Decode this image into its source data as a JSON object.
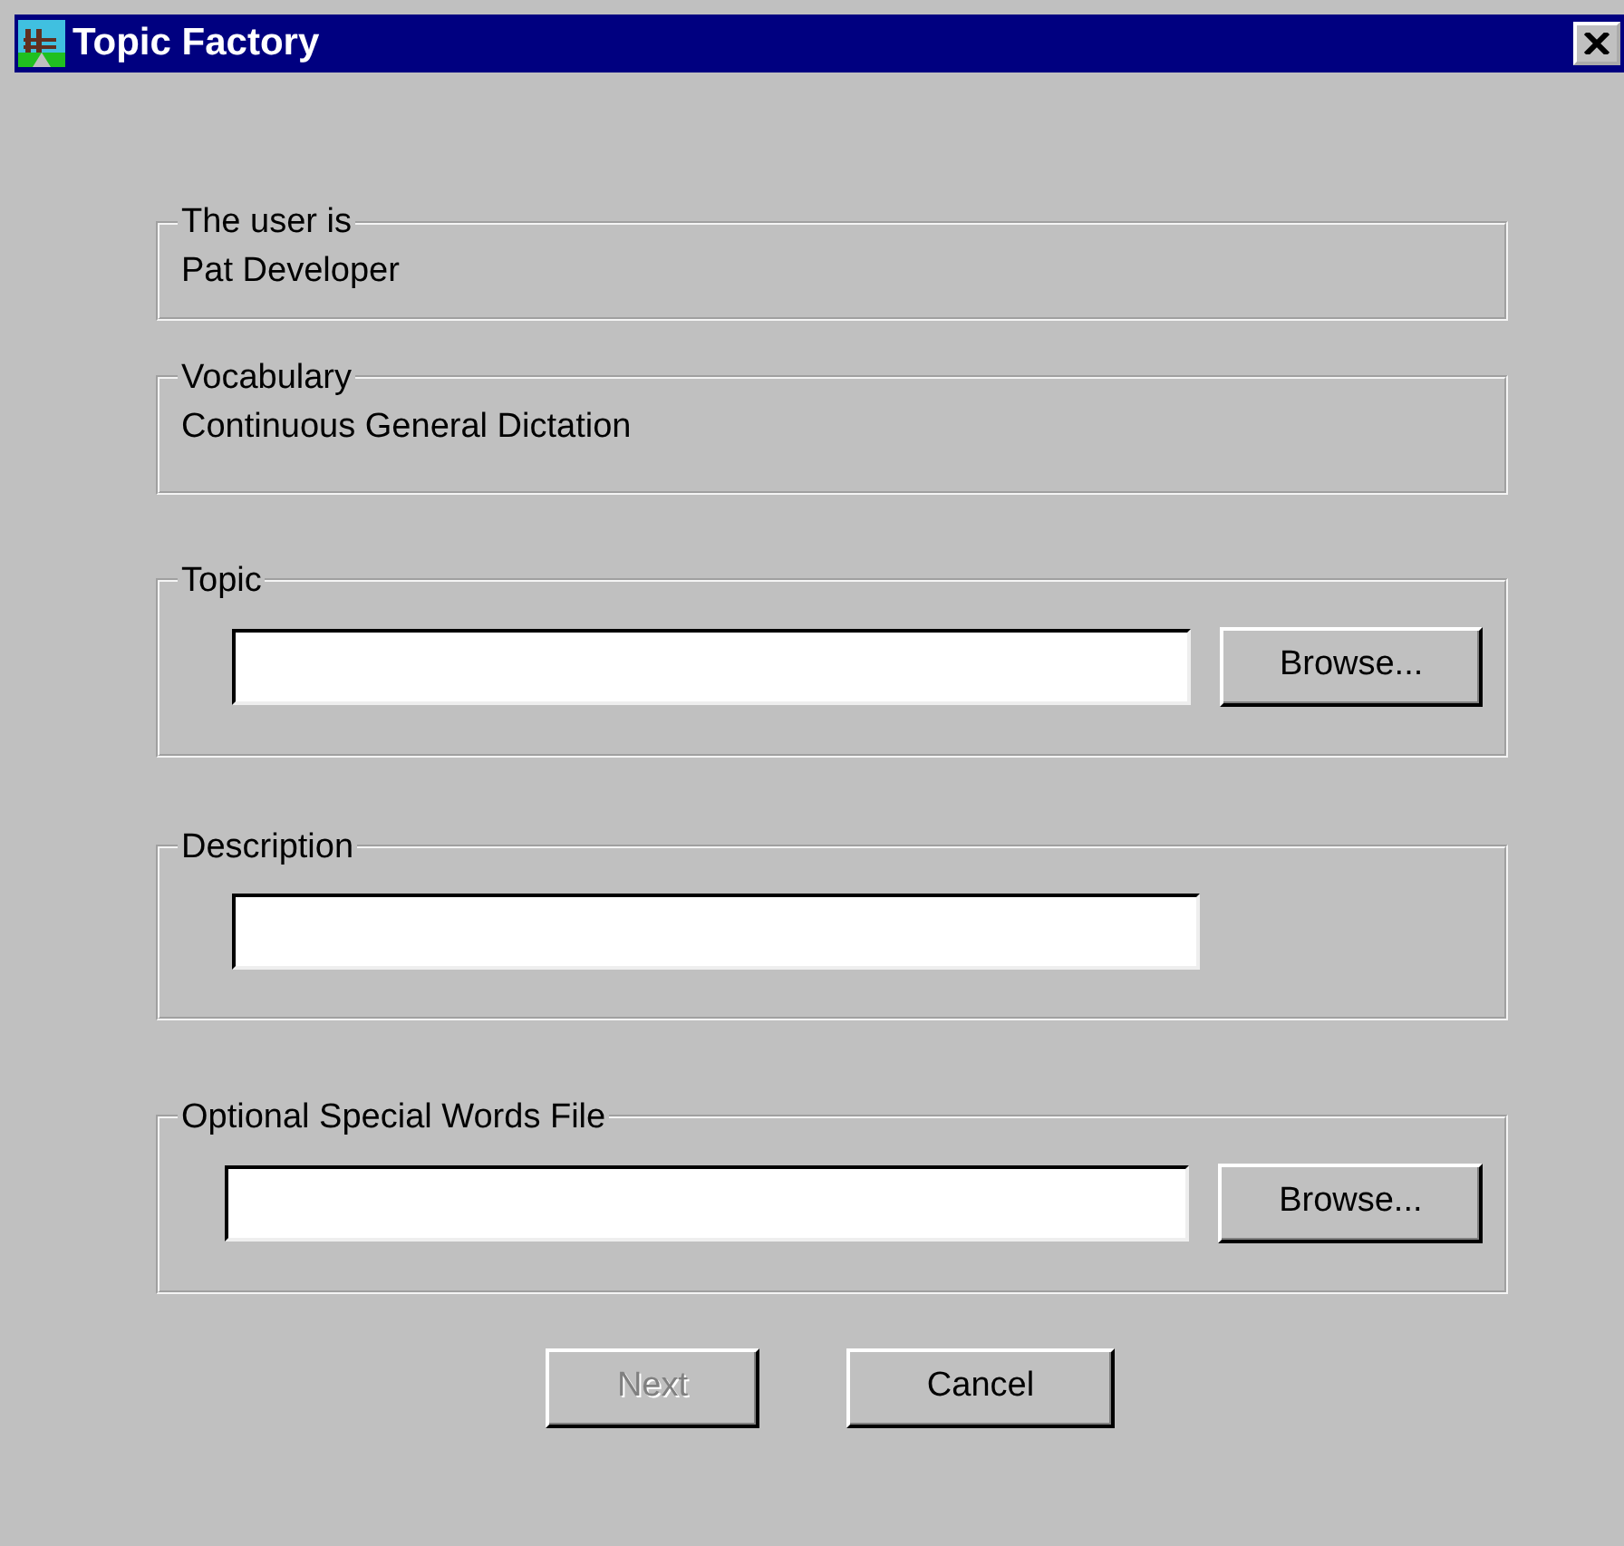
{
  "window": {
    "title": "Topic Factory"
  },
  "groups": [
    {
      "kind": "info",
      "label": "The user is",
      "value": "Pat Developer"
    },
    {
      "kind": "info",
      "label": "Vocabulary",
      "value": "Continuous General Dictation"
    },
    {
      "kind": "file",
      "label": "Topic",
      "button": "Browse..."
    },
    {
      "kind": "text",
      "label": "Description"
    },
    {
      "kind": "file",
      "label": "Optional Special Words File",
      "button": "Browse..."
    }
  ],
  "buttons": [
    {
      "label": "Next",
      "disabled": true
    },
    {
      "label": "Cancel",
      "disabled": false
    }
  ]
}
